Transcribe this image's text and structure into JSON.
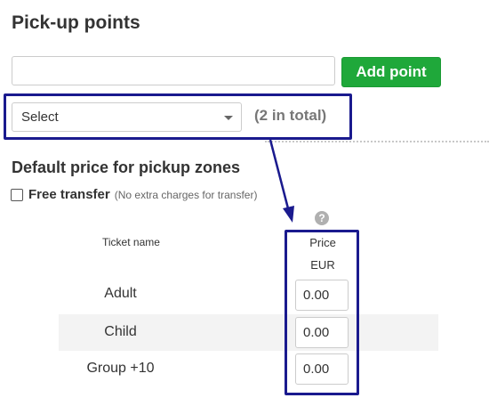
{
  "heading": "Pick-up points",
  "pickup_input": {
    "value": "",
    "placeholder": ""
  },
  "add_button": "Add point",
  "select": {
    "selected": "Select",
    "count_text": "(2 in total)"
  },
  "section_title": "Default price for pickup zones",
  "free_transfer": {
    "label": "Free transfer",
    "note": "(No extra charges for transfer)",
    "checked": false
  },
  "help_icon": "?",
  "table": {
    "headers": {
      "ticket": "Ticket name",
      "price": "Price",
      "currency": "EUR"
    },
    "rows": [
      {
        "name": "Adult",
        "price": "0.00"
      },
      {
        "name": "Child",
        "price": "0.00"
      },
      {
        "name": "Group +10",
        "price": "0.00"
      }
    ]
  },
  "colors": {
    "accent_green": "#1fa83a",
    "annotation_navy": "#1a1a8e"
  }
}
